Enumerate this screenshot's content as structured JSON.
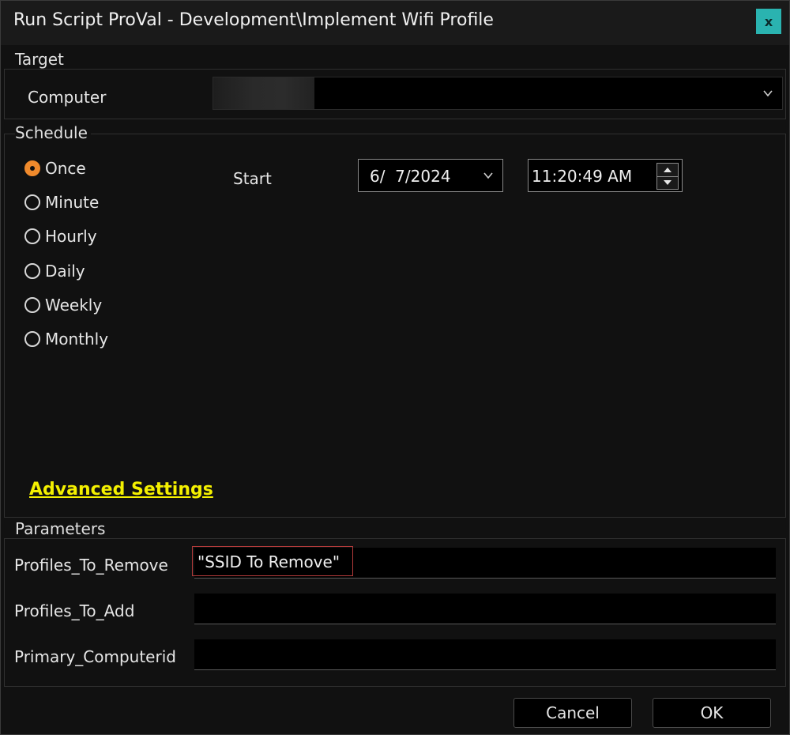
{
  "window": {
    "title": "Run Script ProVal - Development\\Implement Wifi Profile",
    "close_label": "x"
  },
  "target": {
    "group_label": "Target",
    "computer_label": "Computer",
    "computer_value": ""
  },
  "schedule": {
    "group_label": "Schedule",
    "options": [
      {
        "label": "Once",
        "checked": true
      },
      {
        "label": "Minute",
        "checked": false
      },
      {
        "label": "Hourly",
        "checked": false
      },
      {
        "label": "Daily",
        "checked": false
      },
      {
        "label": "Weekly",
        "checked": false
      },
      {
        "label": "Monthly",
        "checked": false
      }
    ],
    "start_label": "Start",
    "start_date": "6/  7/2024",
    "start_time": "11:20:49 AM",
    "advanced_settings_label": "Advanced Settings"
  },
  "parameters": {
    "group_label": "Parameters",
    "fields": [
      {
        "label": "Profiles_To_Remove",
        "value": "\"SSID To Remove\""
      },
      {
        "label": "Profiles_To_Add",
        "value": ""
      },
      {
        "label": "Primary_Computerid",
        "value": ""
      }
    ]
  },
  "buttons": {
    "cancel_label": "Cancel",
    "ok_label": "OK"
  },
  "colors": {
    "accent_radio": "#f08a2c",
    "close_button": "#2ab3b0",
    "link": "#f4f000",
    "highlight_border": "#b33a3a"
  },
  "icons": {
    "dropdown": "chevron-down-icon",
    "spin": "spinner-icon",
    "close": "close-icon"
  }
}
